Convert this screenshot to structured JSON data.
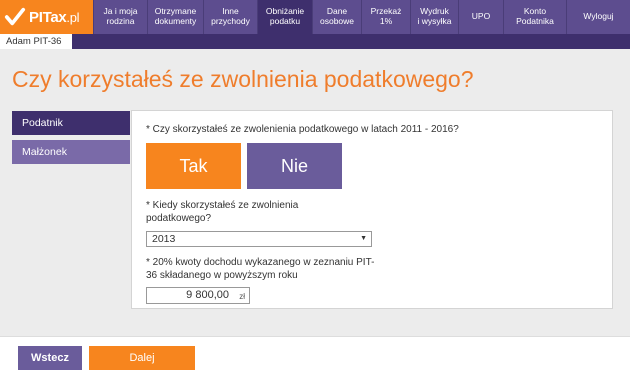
{
  "app": {
    "logo_text": "PITax",
    "logo_suffix": ".pl",
    "user_tab": "Adam PIT-36"
  },
  "nav": [
    {
      "label_1": "Ja i moja",
      "label_2": "rodzina"
    },
    {
      "label_1": "Otrzymane",
      "label_2": "dokumenty"
    },
    {
      "label_1": "Inne",
      "label_2": "przychody"
    },
    {
      "label_1": "Obniżanie",
      "label_2": "podatku"
    },
    {
      "label_1": "Dane",
      "label_2": "osobowe"
    },
    {
      "label_1": "Przekaż",
      "label_2": "1%"
    },
    {
      "label_1": "Wydruk",
      "label_2": "i wysyłka"
    },
    {
      "label_1": "UPO",
      "label_2": ""
    },
    {
      "label_1": "Konto",
      "label_2": "Podatnika"
    },
    {
      "label_1": "Wyloguj",
      "label_2": ""
    }
  ],
  "page": {
    "title": "Czy korzystałeś ze zwolnienia podatkowego?"
  },
  "sidebar": {
    "items": [
      {
        "label": "Podatnik"
      },
      {
        "label": "Małżonek"
      }
    ]
  },
  "form": {
    "q1": "* Czy skorzystałeś ze zwolenienia podatkowego w latach 2011 - 2016?",
    "yes_label": "Tak",
    "no_label": "Nie",
    "q2": "* Kiedy skorzystałeś ze zwolnienia podatkowego?",
    "year_value": "2013",
    "q3": "* 20% kwoty dochodu wykazanego w zeznaniu PIT-36 składanego w powyższym roku",
    "amount_value": "9 800,00",
    "amount_unit": "zł"
  },
  "footer": {
    "back_label": "Wstecz",
    "next_label": "Dalej"
  }
}
